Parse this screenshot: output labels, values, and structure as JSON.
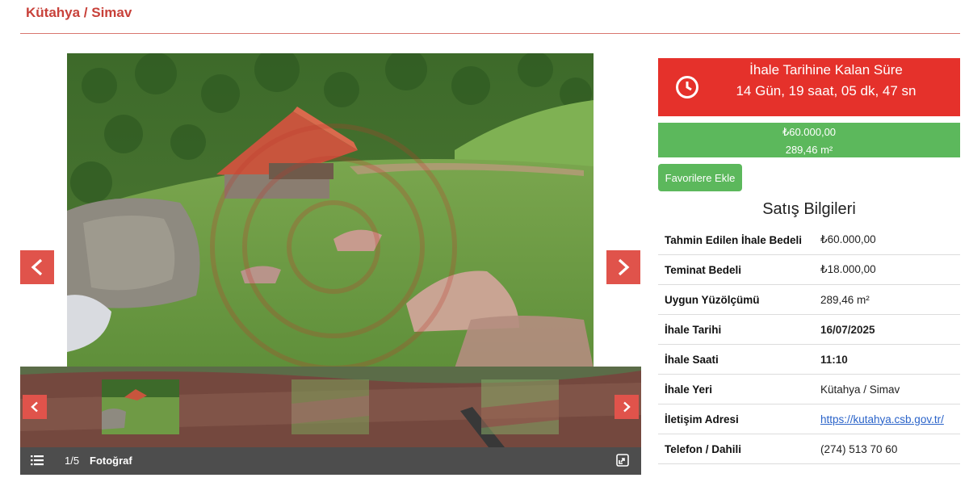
{
  "header": {
    "location": "Kütahya / Simav"
  },
  "gallery": {
    "counter": "1/5",
    "label": "Fotoğraf"
  },
  "countdown": {
    "title": "İhale Tarihine Kalan Süre",
    "value": "14 Gün, 19 saat, 05 dk, 47 sn",
    "color": "#e5312b"
  },
  "price_box": {
    "price": "₺60.000,00",
    "area": "289,46 m²",
    "color": "#5cb85c"
  },
  "favorite_button": {
    "label": "Favorilere Ekle"
  },
  "sale_info": {
    "title": "Satış Bilgileri",
    "rows": [
      {
        "label": "Tahmin Edilen İhale Bedeli",
        "value": "₺60.000,00"
      },
      {
        "label": "Teminat Bedeli",
        "value": "₺18.000,00"
      },
      {
        "label": "Uygun Yüzölçümü",
        "value": "289,46 m²"
      },
      {
        "label": "İhale Tarihi",
        "value": "16/07/2025"
      },
      {
        "label": "İhale Saati",
        "value": "11:10"
      },
      {
        "label": "İhale Yeri",
        "value": "Kütahya / Simav"
      },
      {
        "label": "İletişim Adresi",
        "value": "https://kutahya.csb.gov.tr/"
      },
      {
        "label": "Telefon / Dahili",
        "value": "(274) 513 70 60"
      }
    ]
  },
  "icons": {
    "clock": "clock-icon",
    "list": "list-icon",
    "expand": "expand-icon",
    "chevron_left": "chevron-left-icon",
    "chevron_right": "chevron-right-icon"
  },
  "accent_color": "#e0534b"
}
